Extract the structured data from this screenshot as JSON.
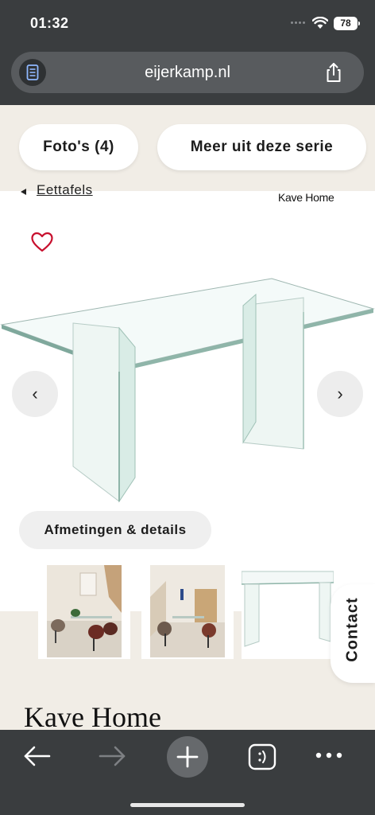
{
  "status_bar": {
    "time": "01:32",
    "battery": "78"
  },
  "browser": {
    "url": "eijerkamp.nl",
    "reader_icon": "document-icon",
    "share_icon": "share-icon"
  },
  "product_tabs": {
    "photos_label": "Foto's (4)",
    "more_label": "Meer uit deze serie"
  },
  "breadcrumb": {
    "label": "Eettafels"
  },
  "brand": {
    "logo_text": "Kave Home",
    "heading": "Kave Home"
  },
  "gallery": {
    "prev_symbol": "‹",
    "next_symbol": "›"
  },
  "details_button": {
    "label": "Afmetingen & details"
  },
  "contact": {
    "label": "Contact"
  },
  "colors": {
    "status_bar": "#3a3d3f",
    "url_pill": "#585b5e",
    "beige": "#f1ede6",
    "heart": "#c8102e"
  }
}
